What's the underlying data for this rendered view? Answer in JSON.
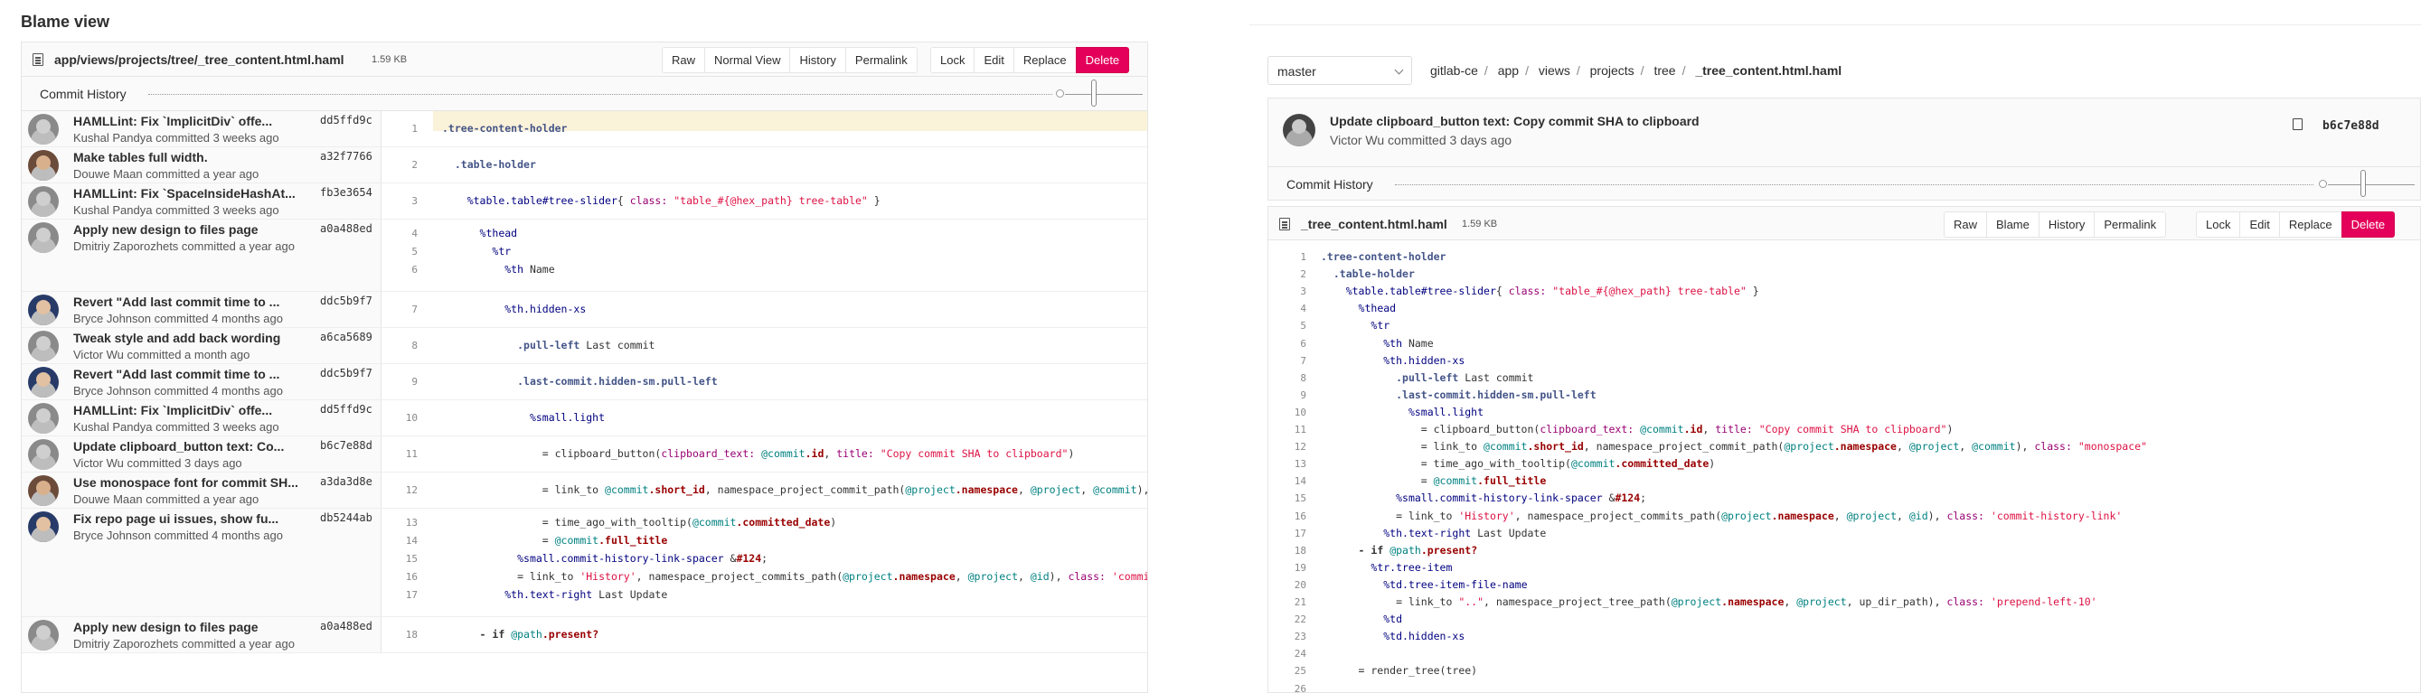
{
  "blame": {
    "title": "Blame view",
    "file_path": "app/views/projects/tree/_tree_content.html.haml",
    "file_size": "1.59 KB",
    "buttons": [
      "Raw",
      "Normal View",
      "History",
      "Permalink",
      "Lock",
      "Edit",
      "Replace",
      "Delete"
    ],
    "commit_history_label": "Commit History",
    "commits": [
      {
        "title": "HAMLLint: Fix `ImplicitDiv` offe...",
        "author": "Kushal Pandya committed 3 weeks ago",
        "sha": "dd5ffd9c",
        "lines": [
          "1"
        ]
      },
      {
        "title": "Make tables full width.",
        "author": "Douwe Maan committed a year ago",
        "sha": "a32f7766",
        "lines": [
          "2"
        ]
      },
      {
        "title": "HAMLLint: Fix `SpaceInsideHashAt...",
        "author": "Kushal Pandya committed 3 weeks ago",
        "sha": "fb3e3654",
        "lines": [
          "3"
        ]
      },
      {
        "title": "Apply new design to files page",
        "author": "Dmitriy Zaporozhets committed a year ago",
        "sha": "a0a488ed",
        "lines": [
          "4",
          "5",
          "6"
        ]
      },
      {
        "title": "Revert \"Add last commit time to ...",
        "author": "Bryce Johnson committed 4 months ago",
        "sha": "ddc5b9f7",
        "lines": [
          "7"
        ]
      },
      {
        "title": "Tweak style and add back wording",
        "author": "Victor Wu committed a month ago",
        "sha": "a6ca5689",
        "lines": [
          "8"
        ]
      },
      {
        "title": "Revert \"Add last commit time to ...",
        "author": "Bryce Johnson committed 4 months ago",
        "sha": "ddc5b9f7",
        "lines": [
          "9"
        ]
      },
      {
        "title": "HAMLLint: Fix `ImplicitDiv` offe...",
        "author": "Kushal Pandya committed 3 weeks ago",
        "sha": "dd5ffd9c",
        "lines": [
          "10"
        ]
      },
      {
        "title": "Update clipboard_button text: Co...",
        "author": "Victor Wu committed 3 days ago",
        "sha": "b6c7e88d",
        "lines": [
          "11"
        ]
      },
      {
        "title": "Use monospace font for commit SH...",
        "author": "Douwe Maan committed a year ago",
        "sha": "a3da3d8e",
        "lines": [
          "12"
        ]
      },
      {
        "title": "Fix repo page ui issues, show fu...",
        "author": "Bryce Johnson committed 4 months ago",
        "sha": "db5244ab",
        "lines": [
          "13",
          "14",
          "15",
          "16",
          "17"
        ]
      },
      {
        "title": "Apply new design to files page",
        "author": "Dmitriy Zaporozhets committed a year ago",
        "sha": "a0a488ed",
        "lines": [
          "18"
        ]
      }
    ]
  },
  "fileview": {
    "branch": "master",
    "breadcrumb": [
      "gitlab-ce",
      "app",
      "views",
      "projects",
      "tree",
      "_tree_content.html.haml"
    ],
    "commit_title": "Update clipboard_button text: Copy commit SHA to clipboard",
    "commit_author": "Victor Wu committed 3 days ago",
    "commit_sha": "b6c7e88d",
    "commit_history_label": "Commit History",
    "file_name": "_tree_content.html.haml",
    "file_size": "1.59 KB",
    "buttons": [
      "Raw",
      "Blame",
      "History",
      "Permalink",
      "Lock",
      "Edit",
      "Replace",
      "Delete"
    ],
    "line_numbers": [
      "1",
      "2",
      "3",
      "4",
      "5",
      "6",
      "7",
      "8",
      "9",
      "10",
      "11",
      "12",
      "13",
      "14",
      "15",
      "16",
      "17",
      "18",
      "19",
      "20",
      "21",
      "22",
      "23",
      "24",
      "25",
      "26"
    ]
  },
  "code_lines": [
    ".tree-content-holder",
    "  .table-holder",
    "    %table.table#tree-slider{ class: \"table_#{@hex_path} tree-table\" }",
    "      %thead",
    "        %tr",
    "          %th Name",
    "          %th.hidden-xs",
    "            .pull-left Last commit",
    "            .last-commit.hidden-sm.pull-left",
    "              %small.light",
    "                = clipboard_button(clipboard_text: @commit.id, title: \"Copy commit SHA to clipboard\")",
    "                = link_to @commit.short_id, namespace_project_commit_path(@project.namespace, @project, @commit), class: \"monospace\"",
    "                = time_ago_with_tooltip(@commit.committed_date)",
    "                = @commit.full_title",
    "            %small.commit-history-link-spacer &#124;",
    "            = link_to 'History', namespace_project_commits_path(@project.namespace, @project, @id), class: 'commit-history-link'",
    "          %th.text-right Last Update",
    "      - if @path.present?",
    "        %tr.tree-item",
    "          %td.tree-item-file-name",
    "            = link_to \"..\", namespace_project_tree_path(@project.namespace, @project, up_dir_path), class: 'prepend-left-10'",
    "          %td",
    "          %td.hidden-xs",
    "",
    "      = render_tree(tree)",
    ""
  ],
  "colors": {
    "delete_button": "#e4005a",
    "highlight_row": "#fbf2da",
    "panel_bg": "#fafafa"
  }
}
